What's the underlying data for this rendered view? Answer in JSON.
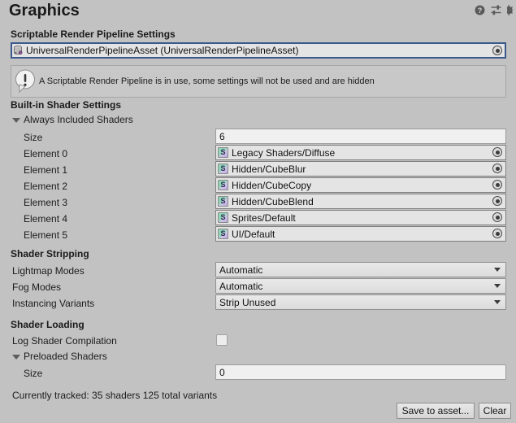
{
  "header": {
    "title": "Graphics",
    "icons": [
      {
        "name": "help-icon",
        "glyph": "?"
      },
      {
        "name": "preset-icon",
        "glyph": "preset"
      },
      {
        "name": "settings-gear-icon",
        "glyph": "gear"
      }
    ]
  },
  "srp": {
    "section_label": "Scriptable Render Pipeline Settings",
    "asset_value": "UniversalRenderPipelineAsset (UniversalRenderPipelineAsset)",
    "asset_icon": "urp-asset-icon",
    "picker_icon": "object-picker-icon"
  },
  "helpbox": {
    "icon": "info-warning-icon",
    "message": "A Scriptable Render Pipeline is in use, some settings will not be used and are hidden"
  },
  "builtin": {
    "section_label": "Built-in Shader Settings",
    "foldout_label": "Always Included Shaders",
    "size_label": "Size",
    "size_value": "6",
    "elements": [
      {
        "label": "Element 0",
        "value": "Legacy Shaders/Diffuse",
        "icon": "shader-icon"
      },
      {
        "label": "Element 1",
        "value": "Hidden/CubeBlur",
        "icon": "shader-icon"
      },
      {
        "label": "Element 2",
        "value": "Hidden/CubeCopy",
        "icon": "shader-icon"
      },
      {
        "label": "Element 3",
        "value": "Hidden/CubeBlend",
        "icon": "shader-icon"
      },
      {
        "label": "Element 4",
        "value": "Sprites/Default",
        "icon": "shader-icon"
      },
      {
        "label": "Element 5",
        "value": "UI/Default",
        "icon": "shader-icon"
      }
    ]
  },
  "stripping": {
    "section_label": "Shader Stripping",
    "rows": [
      {
        "label": "Lightmap Modes",
        "value": "Automatic"
      },
      {
        "label": "Fog Modes",
        "value": "Automatic"
      },
      {
        "label": "Instancing Variants",
        "value": "Strip Unused"
      }
    ]
  },
  "loading": {
    "section_label": "Shader Loading",
    "log_label": "Log Shader Compilation",
    "log_checked": false,
    "preloaded_foldout": "Preloaded Shaders",
    "size_label": "Size",
    "size_value": "0"
  },
  "footer": {
    "status": "Currently tracked: 35 shaders 125 total variants",
    "save_label": "Save to asset...",
    "clear_label": "Clear"
  },
  "colors": {
    "window_bg": "#c2c2c2",
    "field_bg": "#f0f0f0",
    "object_field_bg": "#e4e4e4",
    "focus_border": "#3b5a8c",
    "text": "#1c1c1c"
  }
}
